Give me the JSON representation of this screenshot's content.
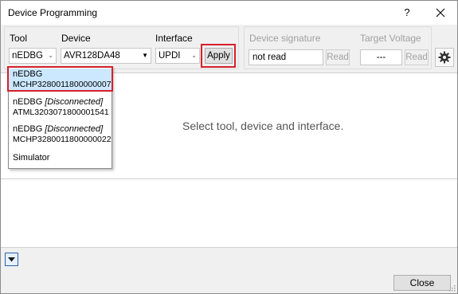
{
  "window": {
    "title": "Device Programming",
    "help_glyph": "?"
  },
  "tool_group": {
    "tool_label": "Tool",
    "tool_value": "nEDBG",
    "device_label": "Device",
    "device_value": "AVR128DA48",
    "interface_label": "Interface",
    "interface_value": "UPDI",
    "apply_label": "Apply"
  },
  "signature_group": {
    "signature_label": "Device signature",
    "signature_value": "not read",
    "signature_read_label": "Read",
    "voltage_label": "Target Voltage",
    "voltage_value": "---",
    "voltage_read_label": "Read"
  },
  "content": {
    "placeholder": "Select tool, device and interface."
  },
  "tool_dropdown": {
    "items": [
      {
        "name": "nEDBG",
        "status": "",
        "serial": "MCHP3280011800000007"
      },
      {
        "name": "nEDBG",
        "status": "[Disconnected]",
        "serial": "ATML3203071800001541"
      },
      {
        "name": "nEDBG",
        "status": "[Disconnected]",
        "serial": "MCHP3280011800000022"
      },
      {
        "name": "Simulator",
        "status": "",
        "serial": ""
      }
    ]
  },
  "footer": {
    "close_label": "Close"
  },
  "colors": {
    "highlight": "#d6202b",
    "selected_item": "#cce8ff"
  }
}
